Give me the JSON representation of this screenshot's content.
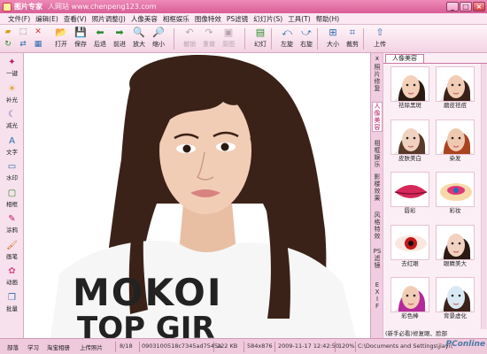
{
  "window": {
    "title": "图片专家",
    "watermark": "人网站 www.chenpeng123.com"
  },
  "menu": [
    "文件(F)",
    "编辑(E)",
    "查看(V)",
    "照片调整(J)",
    "人像美容",
    "相框娱乐",
    "图像特效",
    "PS滤镜",
    "幻灯片(S)",
    "工具(T)",
    "帮助(H)"
  ],
  "toolbar": [
    {
      "label": "打开",
      "icon": "open-folder-icon",
      "glyph": "📂",
      "enabled": true
    },
    {
      "label": "保存",
      "icon": "save-icon",
      "glyph": "💾",
      "enabled": true
    },
    {
      "label": "后退",
      "icon": "arrow-left-icon",
      "glyph": "⬅",
      "enabled": true
    },
    {
      "label": "前进",
      "icon": "arrow-right-icon",
      "glyph": "➡",
      "enabled": true
    },
    {
      "label": "放大",
      "icon": "zoom-in-icon",
      "glyph": "🔍",
      "enabled": true
    },
    {
      "label": "缩小",
      "icon": "zoom-out-icon",
      "glyph": "🔎",
      "enabled": true
    },
    {
      "label": "撤销",
      "icon": "undo-icon",
      "glyph": "↶",
      "enabled": false
    },
    {
      "label": "重做",
      "icon": "redo-icon",
      "glyph": "↷",
      "enabled": false
    },
    {
      "label": "原图",
      "icon": "original-image-icon",
      "glyph": "▣",
      "enabled": false
    },
    {
      "label": "幻灯",
      "icon": "slideshow-icon",
      "glyph": "▤",
      "enabled": true
    },
    {
      "label": "左旋",
      "icon": "rotate-left-icon",
      "glyph": "⤺",
      "enabled": true
    },
    {
      "label": "右旋",
      "icon": "rotate-right-icon",
      "glyph": "⤻",
      "enabled": true
    },
    {
      "label": "大小",
      "icon": "resize-icon",
      "glyph": "⊞",
      "enabled": true
    },
    {
      "label": "裁剪",
      "icon": "crop-icon",
      "glyph": "⌗",
      "enabled": true
    },
    {
      "label": "上传",
      "icon": "upload-icon",
      "glyph": "⇧",
      "enabled": true
    }
  ],
  "left_tools": [
    {
      "label": "一键",
      "icon": "one-click-icon",
      "glyph": "✦"
    },
    {
      "label": "补光",
      "icon": "fill-light-icon",
      "glyph": "☀"
    },
    {
      "label": "减光",
      "icon": "reduce-light-icon",
      "glyph": "☾"
    },
    {
      "label": "文字",
      "icon": "text-icon",
      "glyph": "A"
    },
    {
      "label": "水印",
      "icon": "watermark-icon",
      "glyph": "▭"
    },
    {
      "label": "相框",
      "icon": "frame-icon",
      "glyph": "▢"
    },
    {
      "label": "涂鸦",
      "icon": "doodle-icon",
      "glyph": "✎"
    },
    {
      "label": "画笔",
      "icon": "brush-icon",
      "glyph": "🖌"
    },
    {
      "label": "动画",
      "icon": "animation-icon",
      "glyph": "✿"
    },
    {
      "label": "批量",
      "icon": "batch-icon",
      "glyph": "❒"
    }
  ],
  "side_tabs": [
    {
      "label": "照片修复",
      "active": false
    },
    {
      "label": "人像美容",
      "active": true
    },
    {
      "label": "相框娱乐",
      "active": false
    },
    {
      "label": "影楼效果",
      "active": false
    },
    {
      "label": "风格特效",
      "active": false
    },
    {
      "label": "PS滤镜",
      "active": false
    },
    {
      "label": "EXIF",
      "active": false
    }
  ],
  "panel": {
    "tab_label": "人像美容",
    "items": [
      {
        "label": "祛除黑斑",
        "icon": "spot-removal-thumb"
      },
      {
        "label": "磨皮祛痘",
        "icon": "skin-smooth-thumb"
      },
      {
        "label": "皮肤美白",
        "icon": "skin-whiten-thumb"
      },
      {
        "label": "染发",
        "icon": "hair-dye-thumb"
      },
      {
        "label": "唇彩",
        "icon": "lip-color-thumb"
      },
      {
        "label": "彩妆",
        "icon": "makeup-thumb"
      },
      {
        "label": "去红眼",
        "icon": "red-eye-thumb"
      },
      {
        "label": "眼睛美大",
        "icon": "eye-enlarge-thumb"
      },
      {
        "label": "彩色棒",
        "icon": "color-stick-thumb"
      },
      {
        "label": "背景虚化",
        "icon": "background-blur-thumb"
      }
    ],
    "footer_text": "(新手必看)修复眼、脸部"
  },
  "photo": {
    "shirt_text_1": "MOKOI",
    "shirt_text_2": "TOP GIR"
  },
  "status": {
    "buttons": [
      "部落",
      "学习",
      "淘宝相册",
      "上传照片"
    ],
    "index": "8/18",
    "file_name": "0903100518c7345ad7545a",
    "size": "222 KB",
    "dimensions": "584x876",
    "datetime": "2009-11-17 12:42:50",
    "zoom": "120%",
    "path": "C:\\Documents and Settings\\jiayi\\",
    "brand": "PConline"
  },
  "colors": {
    "title_bar": "#d85d97",
    "accent": "#c21669",
    "chrome": "#f4d6e6"
  }
}
